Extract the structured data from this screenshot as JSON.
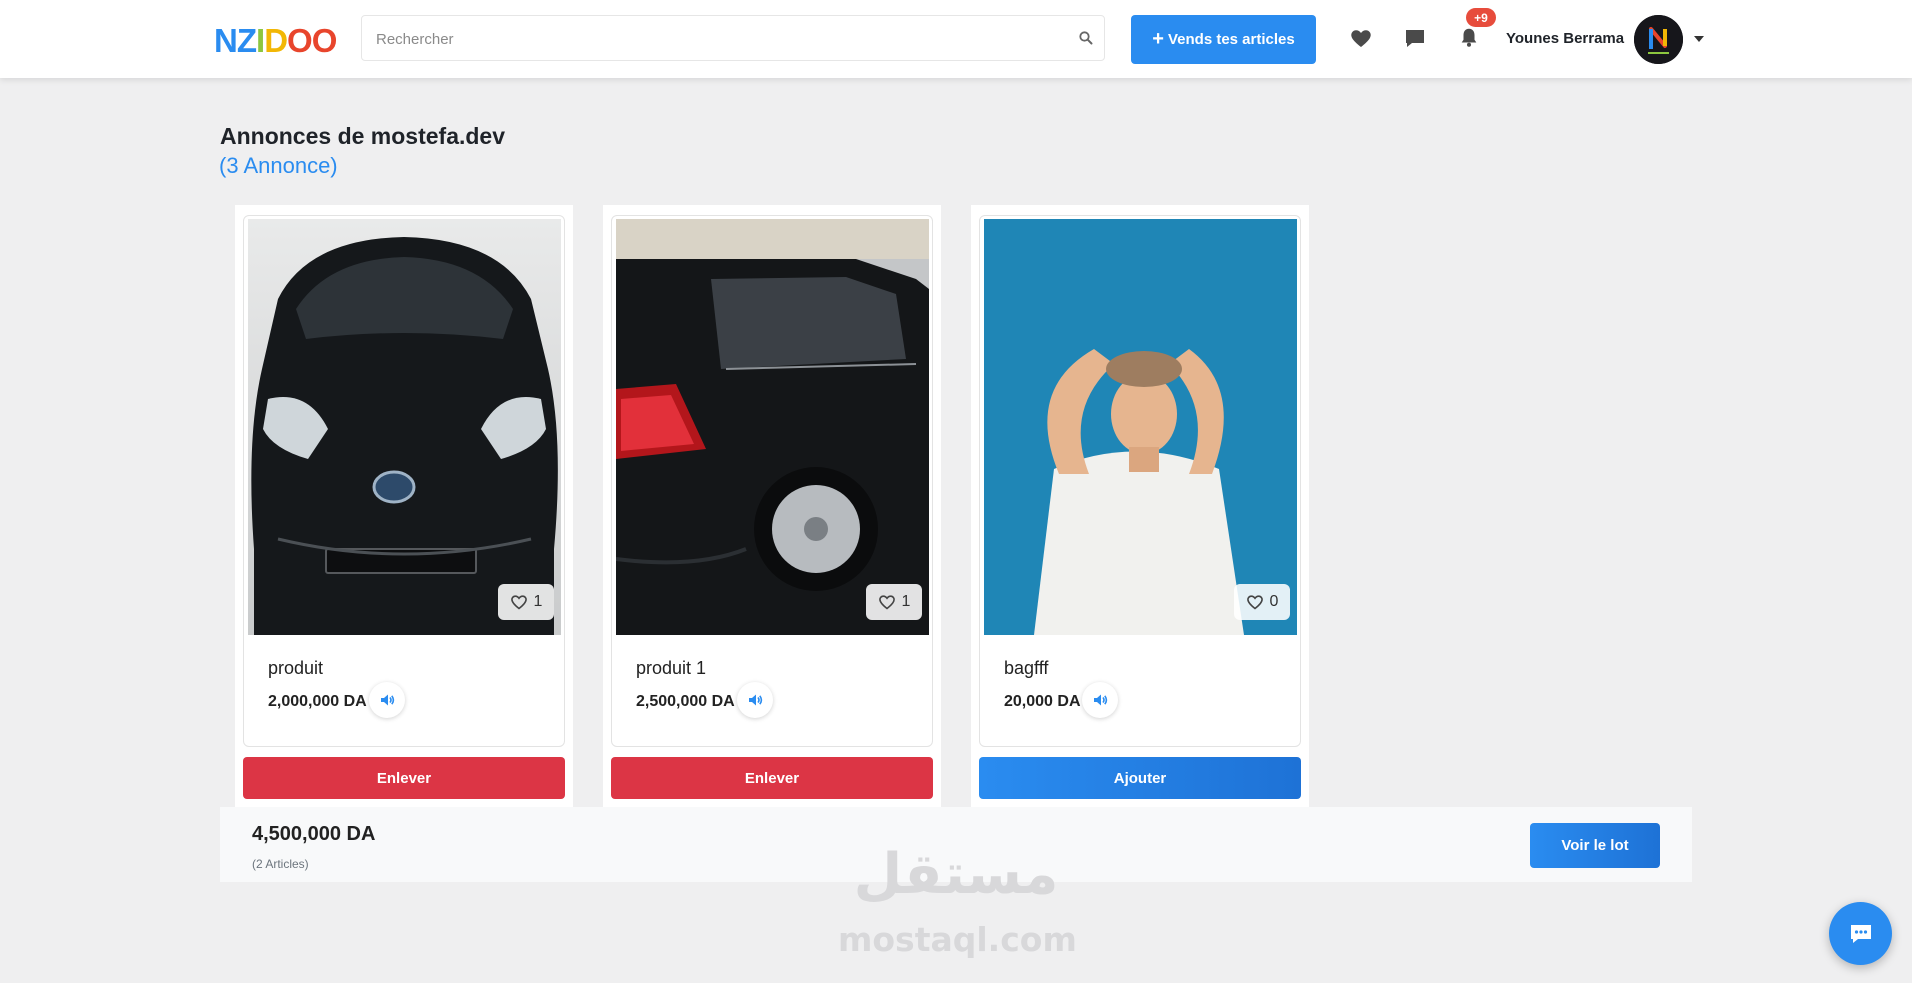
{
  "header": {
    "logo_letters": [
      "N",
      "Z",
      "I",
      "D",
      "O",
      "O"
    ],
    "logo_colors": [
      "#2a8cf0",
      "#2a8cf0",
      "#8cc63f",
      "#f2b705",
      "#e8452c",
      "#e8452c"
    ],
    "search_placeholder": "Rechercher",
    "sell_button_plus": "+",
    "sell_button_label": "Vends tes articles",
    "notification_badge": "+9",
    "username": "Younes Berrama"
  },
  "page": {
    "title": "Annonces de mostefa.dev",
    "subtitle": "(3 Annonce)"
  },
  "products": [
    {
      "name": "produit",
      "price": "2,000,000 DA",
      "likes": "1",
      "action": "Enlever",
      "action_color": "#dc3545"
    },
    {
      "name": "produit 1",
      "price": "2,500,000 DA",
      "likes": "1",
      "action": "Enlever",
      "action_color": "#dc3545"
    },
    {
      "name": "bagfff",
      "price": "20,000 DA",
      "likes": "0",
      "action": "Ajouter",
      "action_color": "#2a8cf0"
    }
  ],
  "summary": {
    "total": "4,500,000 DA",
    "count": "(2 Articles)",
    "button_label": "Voir le lot"
  },
  "watermark": {
    "arabic": "مستقل",
    "latin": "mostaql.com"
  },
  "colors": {
    "accent": "#2a8cf0",
    "danger": "#dc3545",
    "badge": "#e74c3c"
  }
}
